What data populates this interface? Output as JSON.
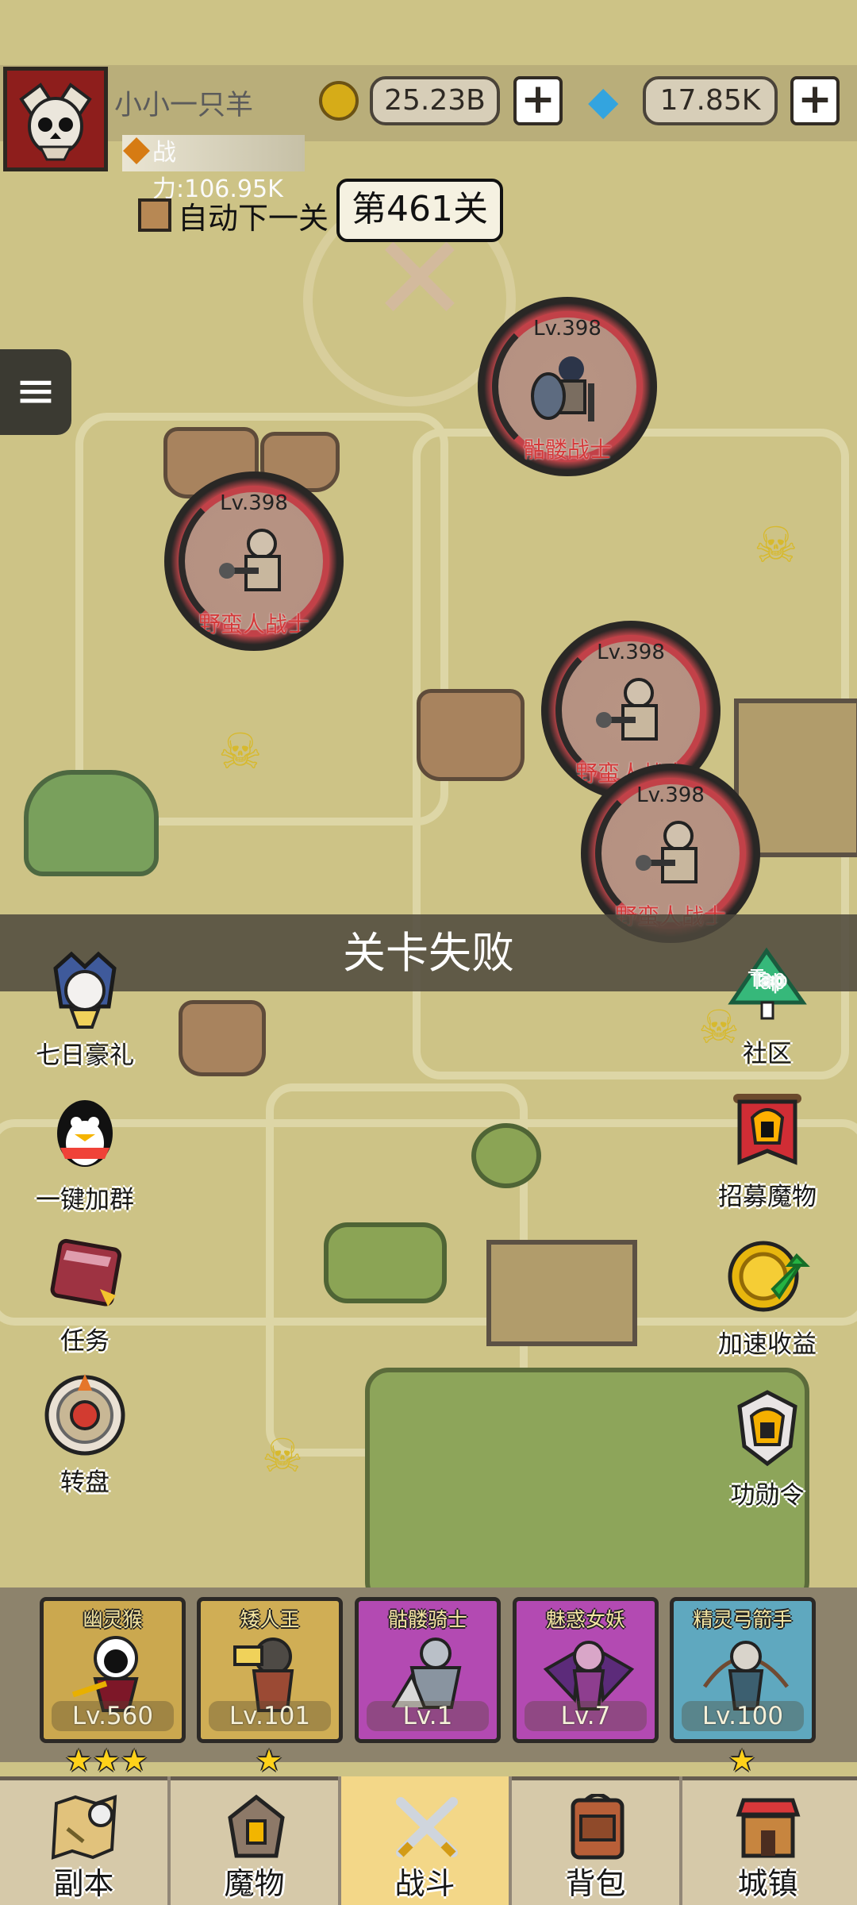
{
  "player": {
    "name": "小小一只羊",
    "power": "战力:106.95K",
    "coins": "25.23B",
    "gems": "17.85K"
  },
  "battle": {
    "auto_next": "自动下一关",
    "stage": "第461关",
    "result": "关卡失败"
  },
  "enemies": [
    {
      "level": "Lv.398",
      "name": "骷髅战士"
    },
    {
      "level": "Lv.398",
      "name": "野蛮人战士"
    },
    {
      "level": "Lv.398",
      "name": "野蛮人战士"
    },
    {
      "level": "Lv.398",
      "name": "野蛮人战士"
    }
  ],
  "left_menu": [
    "七日豪礼",
    "一键加群",
    "任务",
    "转盘"
  ],
  "right_menu": [
    "社区",
    "招募魔物",
    "加速收益",
    "功勋令"
  ],
  "heroes": [
    {
      "name": "幽灵猴",
      "level": "Lv.560",
      "stars": "★★★",
      "color": "#cba84f"
    },
    {
      "name": "矮人王",
      "level": "Lv.101",
      "stars": "★",
      "color": "#d0ae55"
    },
    {
      "name": "骷髅骑士",
      "level": "Lv.1",
      "stars": "",
      "color": "#b34ab2"
    },
    {
      "name": "魅惑女妖",
      "level": "Lv.7",
      "stars": "",
      "color": "#b34ab2"
    },
    {
      "name": "精灵弓箭手",
      "level": "Lv.100",
      "stars": "★",
      "color": "#5fa8bf"
    }
  ],
  "nav": [
    "副本",
    "魔物",
    "战斗",
    "背包",
    "城镇"
  ],
  "icons": {
    "coin": "coin-icon",
    "gem": "gem-icon",
    "power": "power-icon",
    "menu": "menu-icon"
  },
  "colors": {
    "map_background": "#cdc386",
    "failure_banner": "#4e483d",
    "active_tab": "#f3d788",
    "enemy_ring": "#c24148"
  }
}
